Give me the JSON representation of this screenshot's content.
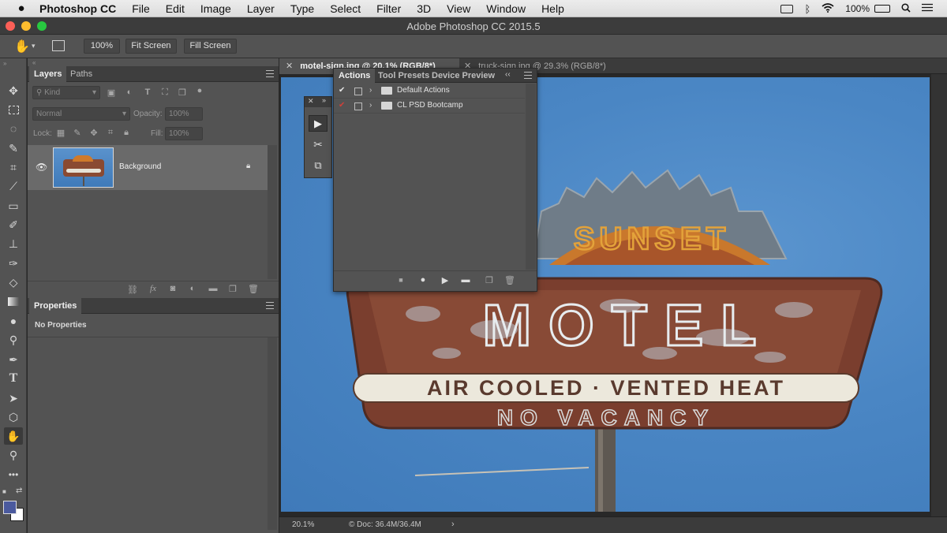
{
  "menubar": {
    "apple": "",
    "items": [
      "Photoshop CC",
      "File",
      "Edit",
      "Image",
      "Layer",
      "Type",
      "Select",
      "Filter",
      "3D",
      "View",
      "Window",
      "Help"
    ],
    "battery": "100%"
  },
  "window": {
    "title": "Adobe Photoshop CC 2015.5"
  },
  "options": {
    "zoom": "100%",
    "fit_screen": "Fit Screen",
    "fill_screen": "Fill Screen"
  },
  "layers_panel": {
    "tabs": [
      "Layers",
      "Paths"
    ],
    "kind_placeholder": "Kind",
    "blend_mode": "Normal",
    "opacity_label": "Opacity:",
    "opacity_value": "100%",
    "lock_label": "Lock:",
    "fill_label": "Fill:",
    "fill_value": "100%",
    "layer_name": "Background"
  },
  "properties_panel": {
    "title": "Properties",
    "empty_text": "No Properties"
  },
  "documents": {
    "active_tab": "motel-sign.jpg @ 20.1% (RGB/8*)",
    "other_tab": "truck-sign.jpg @ 29.3% (RGB/8*)"
  },
  "statusbar": {
    "zoom": "20.1%",
    "doc_info": "Doc: 36.4M/36.4M"
  },
  "actions_panel": {
    "tabs": [
      "Actions",
      "Tool Presets",
      "Device Preview"
    ],
    "sets": [
      {
        "name": "Default Actions",
        "checked": true
      },
      {
        "name": "CL PSD Bootcamp",
        "checked": true
      }
    ]
  },
  "sign": {
    "top_text": "SUNSET",
    "main_text": "MOTEL",
    "band_text": "AIR COOLED · VENTED HEAT",
    "bottom_text": "NO VACANCY"
  },
  "colors": {
    "foreground": "#4b5a9e",
    "background": "#ffffff",
    "canvas_sky": "#4a86c4"
  }
}
